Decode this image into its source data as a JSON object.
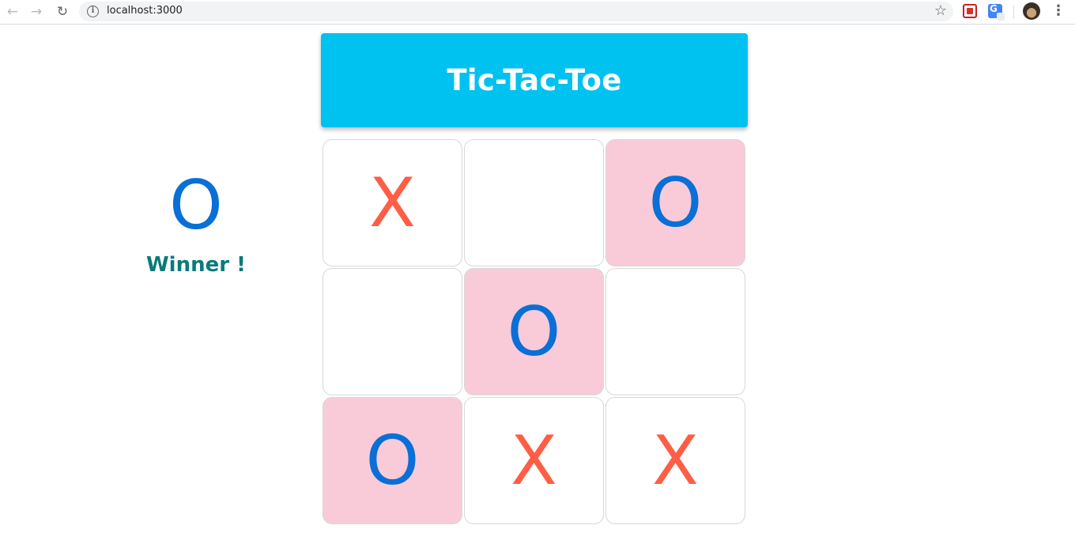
{
  "browser": {
    "url": "localhost:3000",
    "back_icon": "arrow-left-icon",
    "forward_icon": "arrow-right-icon",
    "reload_icon": "reload-icon",
    "back_glyph": "←",
    "forward_glyph": "→",
    "reload_glyph": "↻",
    "star_glyph": "☆",
    "menu_glyph": "⋮",
    "translate_glyph": "G"
  },
  "app": {
    "title": "Tic-Tac-Toe",
    "winner_symbol": "O",
    "winner_label": "Winner !"
  },
  "board": {
    "cells": [
      {
        "value": "X",
        "win": false
      },
      {
        "value": "",
        "win": false
      },
      {
        "value": "O",
        "win": true
      },
      {
        "value": "",
        "win": false
      },
      {
        "value": "O",
        "win": true
      },
      {
        "value": "",
        "win": false
      },
      {
        "value": "O",
        "win": true
      },
      {
        "value": "X",
        "win": false
      },
      {
        "value": "X",
        "win": false
      }
    ]
  },
  "colors": {
    "header_bg": "#00c2f0",
    "x_color": "#ff5e46",
    "o_color": "#0a6fd6",
    "win_cell_bg": "#f9cbd9",
    "winner_text": "#0a7a7a"
  }
}
